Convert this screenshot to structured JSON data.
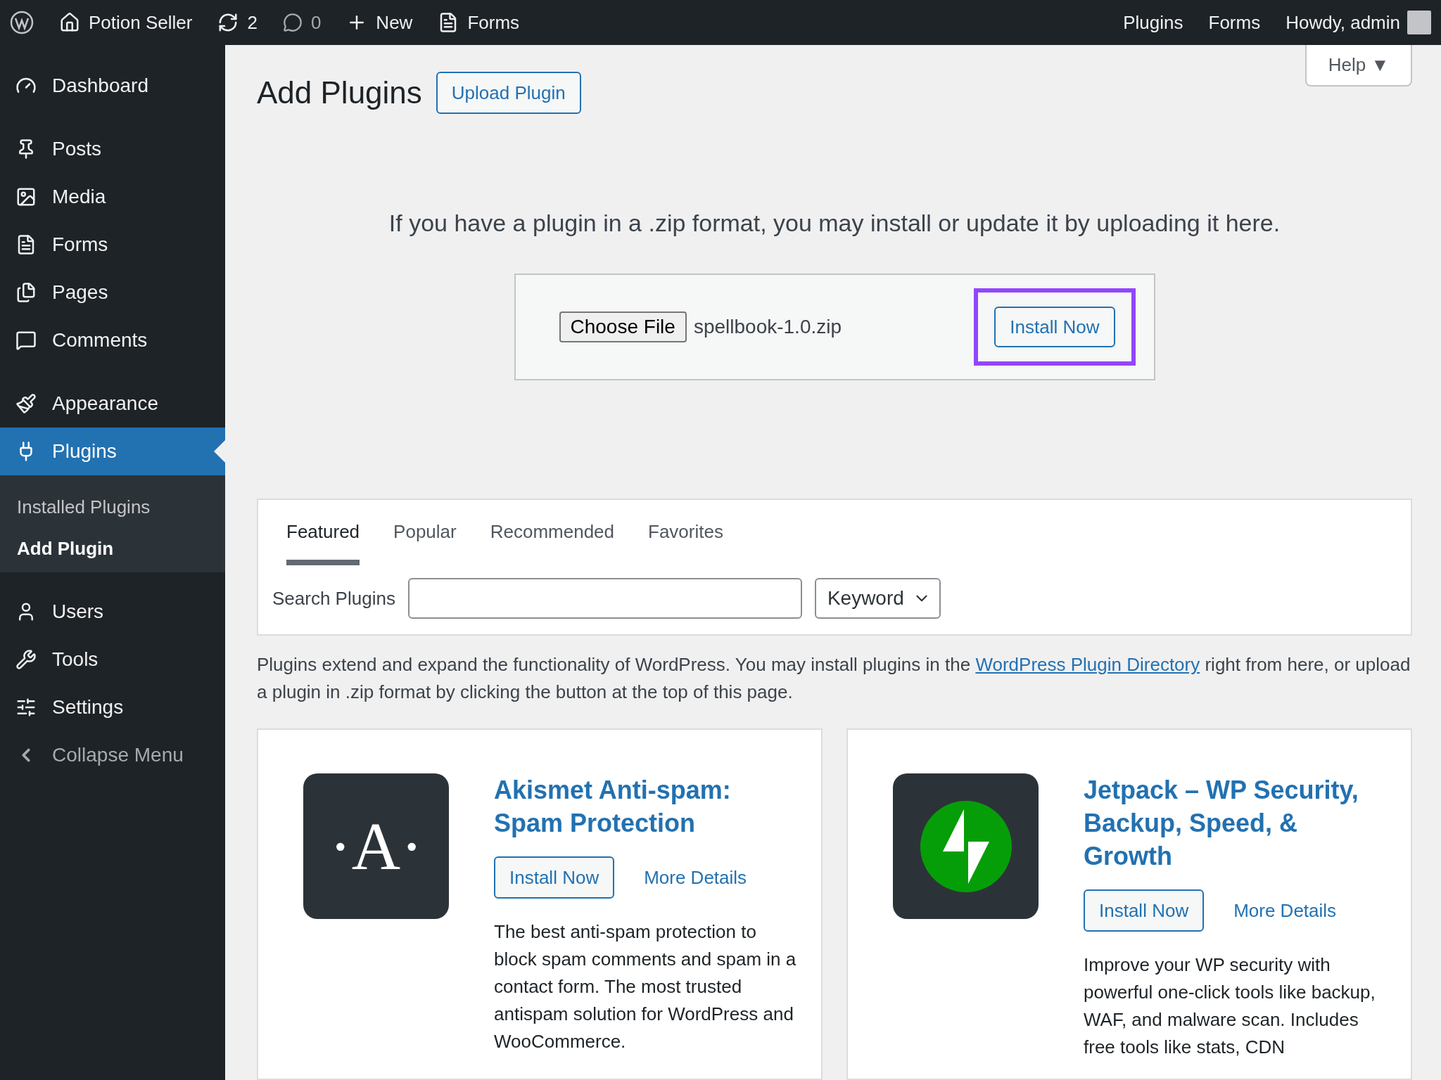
{
  "admin_bar": {
    "site": "Potion Seller",
    "updates": "2",
    "comments": "0",
    "new": "New",
    "forms": "Forms",
    "right_links": [
      "Plugins",
      "Forms"
    ],
    "greeting": "Howdy, admin"
  },
  "sidebar": {
    "items": [
      {
        "label": "Dashboard",
        "selected": false,
        "kind": "item"
      },
      {
        "label": "Posts",
        "selected": false,
        "kind": "item"
      },
      {
        "label": "Media",
        "selected": false,
        "kind": "item"
      },
      {
        "label": "Forms",
        "selected": false,
        "kind": "item"
      },
      {
        "label": "Pages",
        "selected": false,
        "kind": "item"
      },
      {
        "label": "Comments",
        "selected": false,
        "kind": "item"
      },
      {
        "label": "Appearance",
        "selected": false,
        "kind": "item"
      },
      {
        "label": "Plugins",
        "selected": true,
        "kind": "item",
        "children": [
          {
            "label": "Installed Plugins",
            "selected": false
          },
          {
            "label": "Add Plugin",
            "selected": true
          }
        ]
      },
      {
        "label": "Users",
        "selected": false,
        "kind": "item"
      },
      {
        "label": "Tools",
        "selected": false,
        "kind": "item"
      },
      {
        "label": "Settings",
        "selected": false,
        "kind": "item"
      },
      {
        "label": "Collapse Menu",
        "selected": false,
        "kind": "collapse"
      }
    ]
  },
  "page": {
    "title": "Add Plugins",
    "upload_button": "Upload Plugin",
    "help": "Help ▼"
  },
  "upload": {
    "intro": "If you have a plugin in a .zip format, you may install or update it by uploading it here.",
    "choose_button": "Choose File",
    "file_name": "spellbook-1.0.zip",
    "install_button": "Install Now",
    "highlighted": true
  },
  "filter": {
    "tabs": [
      {
        "label": "Featured",
        "selected": true
      },
      {
        "label": "Popular",
        "selected": false
      },
      {
        "label": "Recommended",
        "selected": false
      },
      {
        "label": "Favorites",
        "selected": false
      }
    ],
    "search_label": "Search Plugins",
    "search_type": "Keyword"
  },
  "description": {
    "before": "Plugins extend and expand the functionality of WordPress. You may install plugins in the ",
    "link": "WordPress Plugin Directory",
    "after": " right from here, or upload a plugin in .zip format by clicking the button at the top of this page."
  },
  "plugins": [
    {
      "kind": "akismet",
      "logo_text": "·A·",
      "name": "Akismet Anti-spam: Spam Protection",
      "install": "Install Now",
      "details": "More Details",
      "summary": "The best anti-spam protection to block spam comments and spam in a contact form. The most trusted antispam solution for WordPress and WooCommerce."
    },
    {
      "kind": "jetpack",
      "name": "Jetpack – WP Security, Backup, Speed, & Growth",
      "install": "Install Now",
      "details": "More Details",
      "summary": "Improve your WP security with powerful one-click tools like backup, WAF, and malware scan. Includes free tools like stats, CDN"
    }
  ]
}
